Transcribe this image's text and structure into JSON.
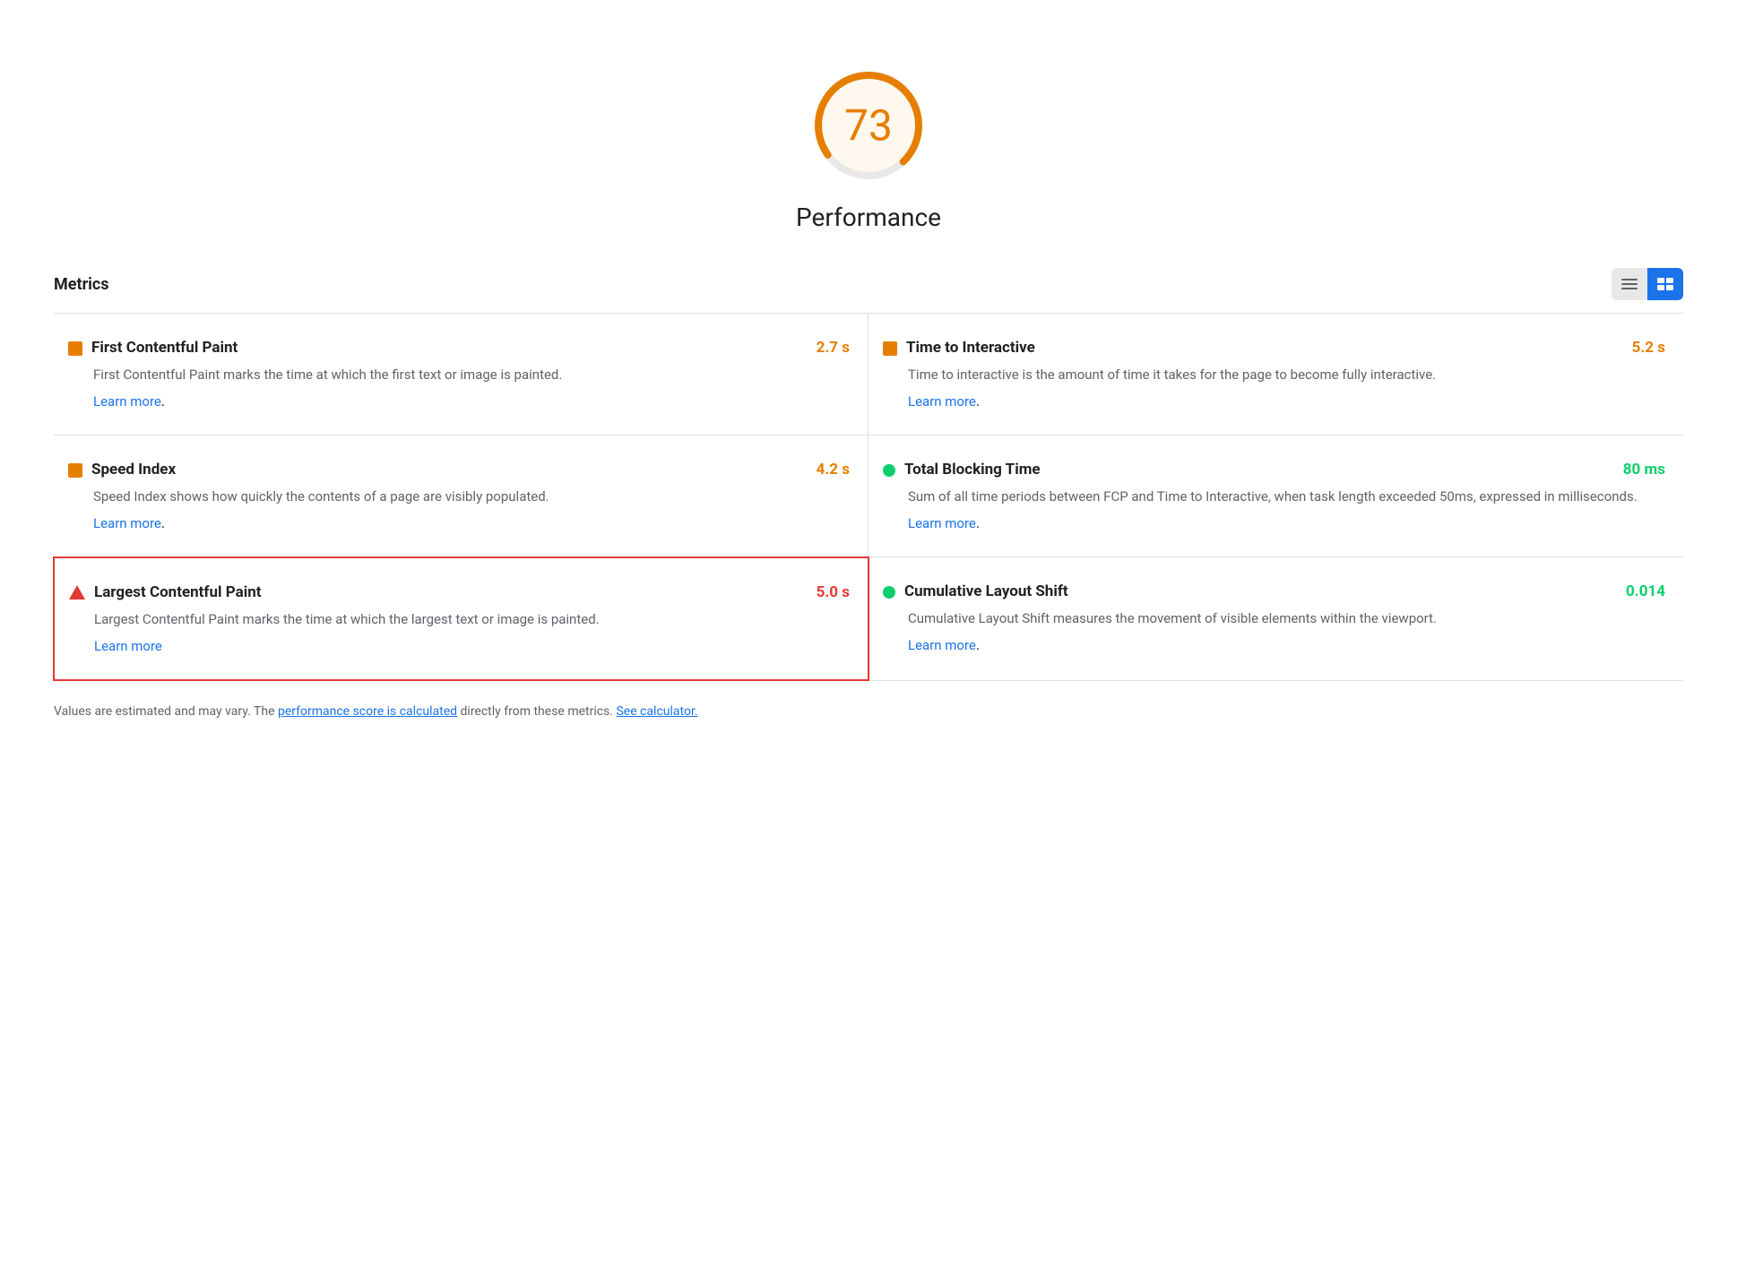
{
  "score": {
    "value": "73",
    "label": "Performance",
    "color": "#e67e00",
    "bg_color": "#fef8ee"
  },
  "metrics_section": {
    "title": "Metrics",
    "view_list_label": "list view",
    "view_detail_label": "detail view"
  },
  "metrics": [
    {
      "id": "fcp",
      "title": "First Contentful Paint",
      "value": "2.7 s",
      "value_class": "orange",
      "icon_type": "square",
      "icon_color": "orange",
      "description": "First Contentful Paint marks the time at which the first text or image is painted.",
      "link_text": "Learn more",
      "link_href": "#",
      "highlighted": false,
      "position": "left"
    },
    {
      "id": "tti",
      "title": "Time to Interactive",
      "value": "5.2 s",
      "value_class": "orange",
      "icon_type": "square",
      "icon_color": "orange",
      "description": "Time to interactive is the amount of time it takes for the page to become fully interactive.",
      "link_text": "Learn more",
      "link_href": "#",
      "highlighted": false,
      "position": "right"
    },
    {
      "id": "si",
      "title": "Speed Index",
      "value": "4.2 s",
      "value_class": "orange",
      "icon_type": "square",
      "icon_color": "orange",
      "description": "Speed Index shows how quickly the contents of a page are visibly populated.",
      "link_text": "Learn more",
      "link_href": "#",
      "highlighted": false,
      "position": "left"
    },
    {
      "id": "tbt",
      "title": "Total Blocking Time",
      "value": "80 ms",
      "value_class": "green",
      "icon_type": "circle",
      "icon_color": "green",
      "description": "Sum of all time periods between FCP and Time to Interactive, when task length exceeded 50ms, expressed in milliseconds.",
      "link_text": "Learn more",
      "link_href": "#",
      "highlighted": false,
      "position": "right"
    },
    {
      "id": "lcp",
      "title": "Largest Contentful Paint",
      "value": "5.0 s",
      "value_class": "red",
      "icon_type": "triangle",
      "icon_color": "red",
      "description": "Largest Contentful Paint marks the time at which the largest text or image is painted.",
      "link_text": "Learn more",
      "link_href": "#",
      "highlighted": true,
      "position": "left"
    },
    {
      "id": "cls",
      "title": "Cumulative Layout Shift",
      "value": "0.014",
      "value_class": "green",
      "icon_type": "circle",
      "icon_color": "green",
      "description": "Cumulative Layout Shift measures the movement of visible elements within the viewport.",
      "link_text": "Learn more",
      "link_href": "#",
      "highlighted": false,
      "position": "right"
    }
  ],
  "footer": {
    "text_before": "Values are estimated and may vary. The ",
    "link1_text": "performance score is calculated",
    "link1_href": "#",
    "text_middle": " directly from these metrics. ",
    "link2_text": "See calculator.",
    "link2_href": "#"
  }
}
